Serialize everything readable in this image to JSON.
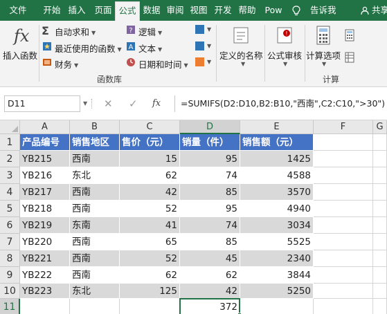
{
  "tabs": [
    "文件",
    "开始",
    "插入",
    "页面",
    "公式",
    "数据",
    "审阅",
    "视图",
    "开发",
    "帮助",
    "Pow"
  ],
  "active_tab": "公式",
  "tell_me": "告诉我",
  "share": "共享",
  "ribbon": {
    "insert_function": "插入函数",
    "autosum": "自动求和",
    "recent": "最近使用的函数",
    "financial": "财务",
    "logical": "逻辑",
    "text": "文本",
    "datetime": "日期和时间",
    "defined_names": "定义的名称",
    "formula_auditing": "公式审核",
    "calc_options": "计算选项",
    "function_library": "函数库",
    "calculation": "计算"
  },
  "formula_bar": {
    "name_box": "D11",
    "cancel": "✕",
    "enter": "✓",
    "fx": "fx",
    "formula": "=SUMIFS(D2:D10,B2:B10,\"西南\",C2:C10,\">30\")"
  },
  "grid": {
    "columns": [
      "A",
      "B",
      "C",
      "D",
      "E",
      "F",
      "G"
    ],
    "rows": [
      "1",
      "2",
      "3",
      "4",
      "5",
      "6",
      "7",
      "8",
      "9",
      "10",
      "11"
    ],
    "selected_cell": "D11",
    "headers": [
      "产品编号",
      "销售地区",
      "售价（元）",
      "销量（件）",
      "销售额（元）"
    ],
    "data": [
      [
        "YB215",
        "西南",
        "15",
        "95",
        "1425"
      ],
      [
        "YB216",
        "东北",
        "62",
        "74",
        "4588"
      ],
      [
        "YB217",
        "西南",
        "42",
        "85",
        "3570"
      ],
      [
        "YB218",
        "西南",
        "52",
        "95",
        "4940"
      ],
      [
        "YB219",
        "东南",
        "41",
        "74",
        "3034"
      ],
      [
        "YB220",
        "西南",
        "65",
        "85",
        "5525"
      ],
      [
        "YB221",
        "西南",
        "52",
        "45",
        "2340"
      ],
      [
        "YB222",
        "西南",
        "62",
        "62",
        "3844"
      ],
      [
        "YB223",
        "东北",
        "125",
        "42",
        "5250"
      ]
    ],
    "result": "372"
  },
  "colors": {
    "excel_green": "#217346",
    "header_blue": "#4472c4",
    "band_gray": "#d9d9d9"
  }
}
